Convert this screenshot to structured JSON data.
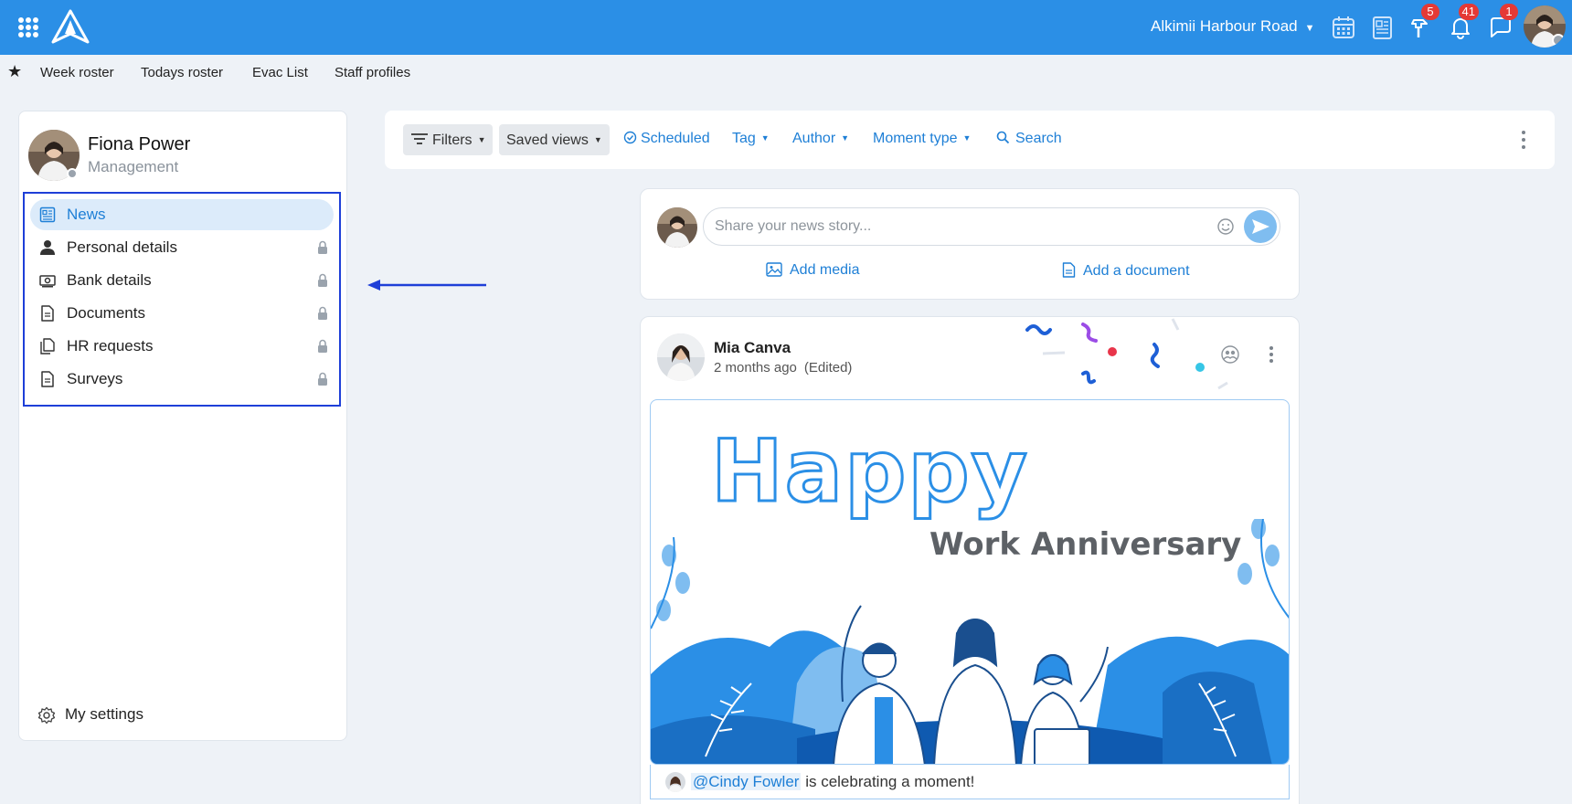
{
  "topbar": {
    "location": "Alkimii Harbour Road",
    "badges": {
      "tasks": "5",
      "notifications": "41",
      "messages": "1"
    }
  },
  "quicklinks": [
    "Week roster",
    "Todays roster",
    "Evac List",
    "Staff profiles"
  ],
  "profile": {
    "name": "Fiona Power",
    "role": "Management"
  },
  "nav": [
    {
      "label": "News",
      "icon": "newspaper-icon",
      "locked": false,
      "active": true
    },
    {
      "label": "Personal details",
      "icon": "person-icon",
      "locked": true
    },
    {
      "label": "Bank details",
      "icon": "money-icon",
      "locked": true
    },
    {
      "label": "Documents",
      "icon": "document-icon",
      "locked": true
    },
    {
      "label": "HR requests",
      "icon": "files-icon",
      "locked": true
    },
    {
      "label": "Surveys",
      "icon": "document-icon",
      "locked": true
    }
  ],
  "settings_label": "My settings",
  "filters": {
    "filters_label": "Filters",
    "saved_views_label": "Saved views",
    "scheduled_label": "Scheduled",
    "tag_label": "Tag",
    "author_label": "Author",
    "moment_type_label": "Moment type",
    "search_label": "Search"
  },
  "composer": {
    "placeholder": "Share your news story...",
    "add_media": "Add media",
    "add_document": "Add a document"
  },
  "post": {
    "author": "Mia Canva",
    "time": "2 months ago",
    "edited": "(Edited)",
    "banner_title": "Happy",
    "banner_subtitle": "Work Anniversary",
    "mention": "@Cindy Fowler",
    "celebration_text": "is celebrating a moment!"
  },
  "colors": {
    "brand": "#2b8fe6",
    "link": "#1e7fd6",
    "highlight_box": "#1e3fd8",
    "badge": "#e53935"
  }
}
